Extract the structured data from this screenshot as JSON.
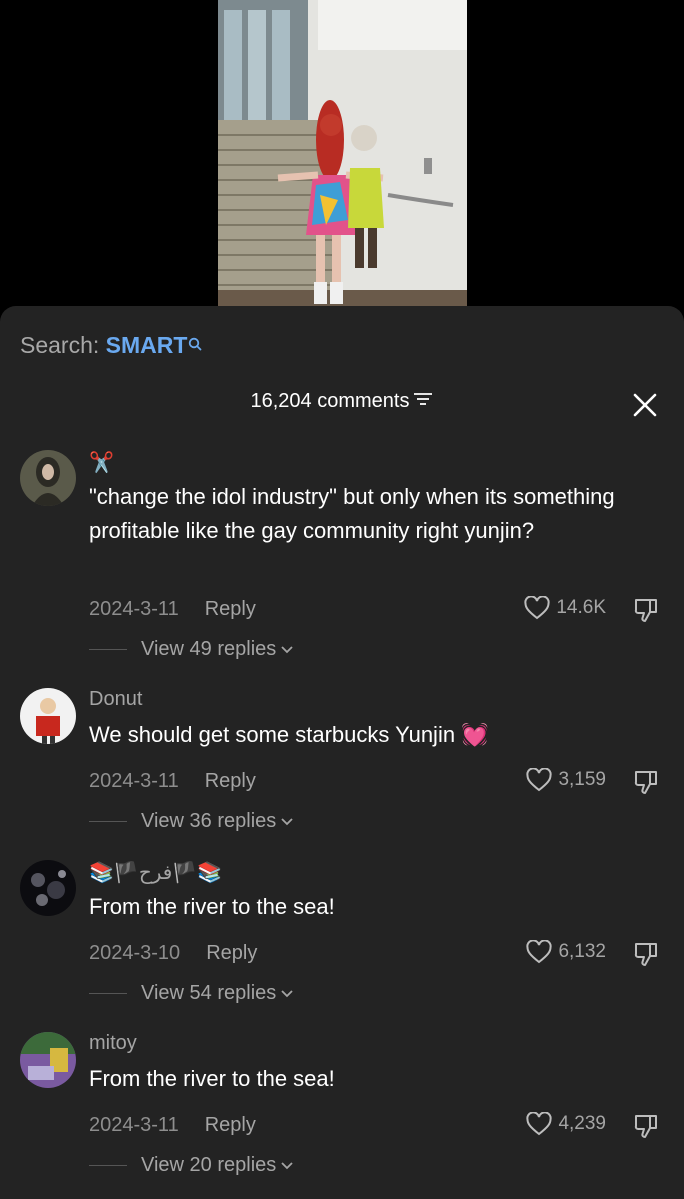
{
  "search": {
    "label": "Search:",
    "term": "SMART"
  },
  "header": {
    "count_label": "16,204 comments"
  },
  "comments": [
    {
      "username": "✂️",
      "text": "\"change the idol industry\" but only when its something profitable like the gay community right yunjin?",
      "date": "2024-3-11",
      "reply_label": "Reply",
      "likes": "14.6K",
      "view_replies": "View 49 replies",
      "avatar_colors": [
        "#5a5a4a",
        "#2b2a24"
      ]
    },
    {
      "username": "Donut",
      "text": "We should get some starbucks Yunjin 💓",
      "date": "2024-3-11",
      "reply_label": "Reply",
      "likes": "3,159",
      "view_replies": "View 36 replies",
      "avatar_colors": [
        "#ffffff",
        "#c8281e"
      ]
    },
    {
      "username": "📚🏴فرح🏴📚",
      "text": "From the river to the sea!",
      "date": "2024-3-10",
      "reply_label": "Reply",
      "likes": "6,132",
      "view_replies": "View 54 replies",
      "avatar_colors": [
        "#3a3a44",
        "#0c0c10"
      ]
    },
    {
      "username": "mitoy",
      "text": "From the river to the sea!",
      "date": "2024-3-11",
      "reply_label": "Reply",
      "likes": "4,239",
      "view_replies": "View 20 replies",
      "avatar_colors": [
        "#7a5aa0",
        "#d6b840"
      ]
    }
  ]
}
